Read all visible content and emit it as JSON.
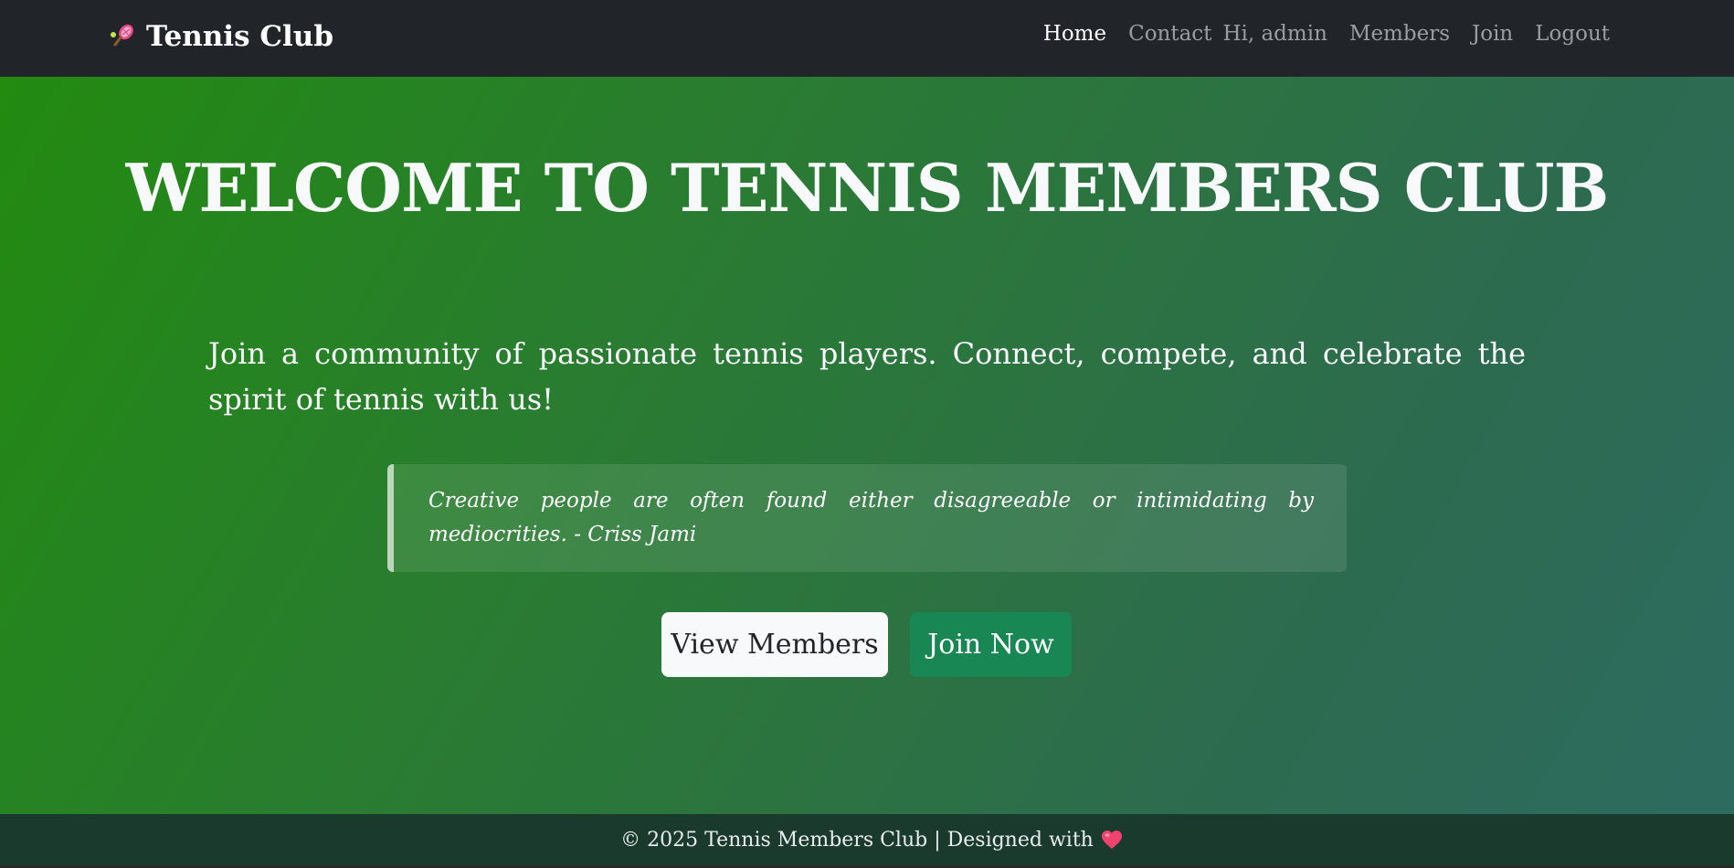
{
  "navbar": {
    "brand": "Tennis Club",
    "brand_icon": "tennis-racket-icon",
    "links": {
      "home": "Home",
      "contact": "Contact",
      "greeting": "Hi, admin",
      "members": "Members",
      "join": "Join",
      "logout": "Logout"
    }
  },
  "hero": {
    "title": "WELCOME TO TENNIS MEMBERS CLUB",
    "lead": "Join a community of passionate tennis players. Connect, compete, and celebrate the spirit of tennis with us!",
    "quote": "Creative people are often found either disagreeable or intimidating by mediocrities. - Criss Jami",
    "buttons": {
      "view_members": "View Members",
      "join_now": "Join Now"
    }
  },
  "footer": {
    "text": "© 2025 Tennis Members Club | Designed with",
    "icon": "heart-icon"
  },
  "colors": {
    "navbar_bg": "#212529",
    "hero_gradient_start": "#228b10",
    "hero_gradient_end": "#2d6b60",
    "success": "#198754",
    "footer_bg": "#1b3a2e"
  }
}
